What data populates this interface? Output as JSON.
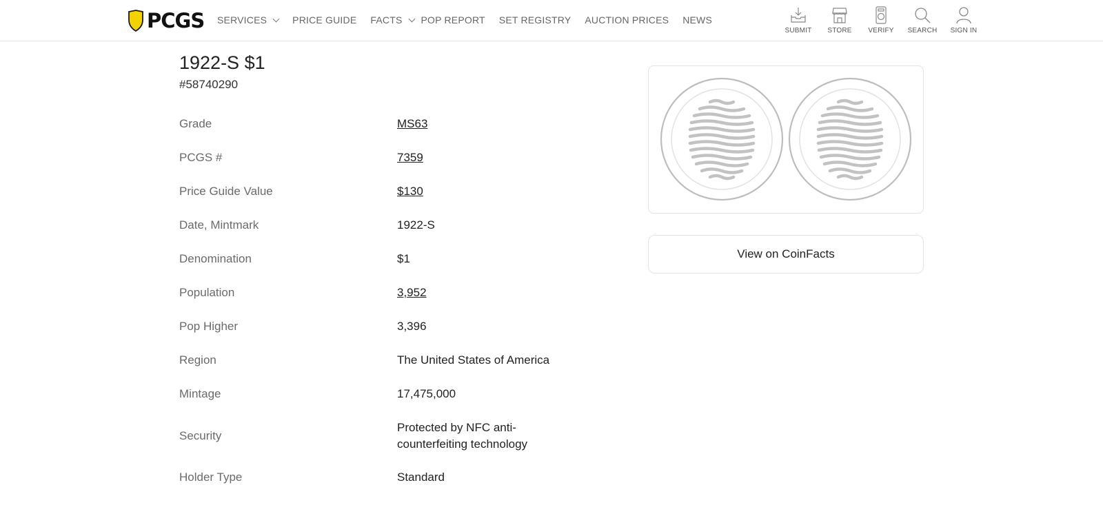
{
  "header": {
    "logo_text": "PCGS",
    "logo_icon": "shield-logo",
    "nav": [
      {
        "label": "SERVICES",
        "has_dropdown": true
      },
      {
        "label": "PRICE GUIDE",
        "has_dropdown": false
      },
      {
        "label": "FACTS",
        "has_dropdown": true
      },
      {
        "label": "POP REPORT",
        "has_dropdown": false
      },
      {
        "label": "SET REGISTRY",
        "has_dropdown": false
      },
      {
        "label": "AUCTION PRICES",
        "has_dropdown": false
      },
      {
        "label": "NEWS",
        "has_dropdown": false
      }
    ],
    "tools": [
      {
        "label": "SUBMIT",
        "icon": "inbox-tray-icon"
      },
      {
        "label": "STORE",
        "icon": "storefront-icon"
      },
      {
        "label": "VERIFY",
        "icon": "verify-holder-icon"
      },
      {
        "label": "SEARCH",
        "icon": "search-icon"
      },
      {
        "label": "SIGN IN",
        "icon": "user-icon"
      }
    ]
  },
  "cert": {
    "title": "1922-S $1",
    "number": "#58740290"
  },
  "details": [
    {
      "label": "Grade",
      "value": "MS63",
      "link": true
    },
    {
      "label": "PCGS #",
      "value": "7359",
      "link": true
    },
    {
      "label": "Price Guide Value",
      "value": "$130",
      "link": true
    },
    {
      "label": "Date, Mintmark",
      "value": "1922-S",
      "link": false
    },
    {
      "label": "Denomination",
      "value": "$1",
      "link": false
    },
    {
      "label": "Population",
      "value": "3,952",
      "link": true
    },
    {
      "label": "Pop Higher",
      "value": "3,396",
      "link": false
    },
    {
      "label": "Region",
      "value": "The United States of America",
      "link": false
    },
    {
      "label": "Mintage",
      "value": "17,475,000",
      "link": false
    },
    {
      "label": "Security",
      "value": "Protected by NFC anti-counterfeiting technology",
      "link": false
    },
    {
      "label": "Holder Type",
      "value": "Standard",
      "link": false
    }
  ],
  "coinfacts_button": "View on CoinFacts",
  "colors": {
    "brand_yellow": "#f2d300",
    "text_dark": "#222222",
    "label_gray": "#6a6a6a",
    "border": "#e3e3e3",
    "coin_placeholder": "#bdbdbd"
  }
}
